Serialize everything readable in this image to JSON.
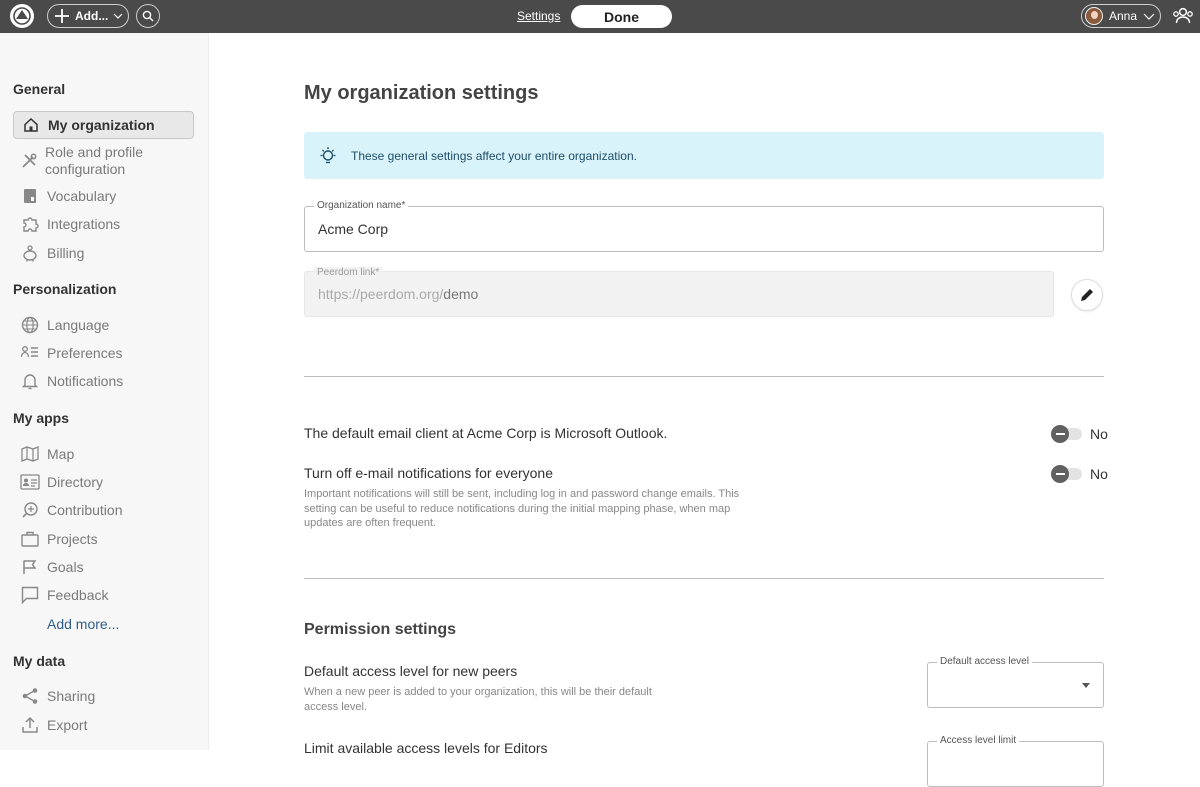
{
  "topbar": {
    "add_label": "Add...",
    "settings_link": "Settings",
    "done_button": "Done",
    "user_name": "Anna"
  },
  "sidebar": {
    "sections": [
      {
        "title": "General",
        "items": [
          {
            "label": "My organization",
            "icon": "home-icon",
            "active": true
          },
          {
            "label": "Role and profile configuration",
            "icon": "tools-icon"
          },
          {
            "label": "Vocabulary",
            "icon": "book-icon"
          },
          {
            "label": "Integrations",
            "icon": "puzzle-icon"
          },
          {
            "label": "Billing",
            "icon": "piggy-bank-icon"
          }
        ]
      },
      {
        "title": "Personalization",
        "items": [
          {
            "label": "Language",
            "icon": "globe-icon"
          },
          {
            "label": "Preferences",
            "icon": "preferences-icon"
          },
          {
            "label": "Notifications",
            "icon": "bell-icon"
          }
        ]
      },
      {
        "title": "My apps",
        "items": [
          {
            "label": "Map",
            "icon": "map-icon"
          },
          {
            "label": "Directory",
            "icon": "directory-icon"
          },
          {
            "label": "Contribution",
            "icon": "contribution-icon"
          },
          {
            "label": "Projects",
            "icon": "briefcase-icon"
          },
          {
            "label": "Goals",
            "icon": "flag-icon"
          },
          {
            "label": "Feedback",
            "icon": "comment-icon"
          }
        ]
      },
      {
        "title": "My data",
        "items": [
          {
            "label": "Sharing",
            "icon": "share-icon"
          },
          {
            "label": "Export",
            "icon": "export-icon"
          }
        ]
      }
    ],
    "add_more": "Add more..."
  },
  "main": {
    "title": "My organization settings",
    "info_text": "These general settings affect your entire organization.",
    "org_name": {
      "label": "Organization name*",
      "value": "Acme Corp"
    },
    "peerdom_link": {
      "label": "Peerdom link*",
      "prefix": "https://peerdom.org/",
      "slug": "demo"
    },
    "email_client": {
      "label": "The default email client at Acme Corp is Microsoft Outlook.",
      "toggle": "No"
    },
    "email_notifications": {
      "label": "Turn off e-mail notifications for everyone",
      "description": "Important notifications will still be sent, including log in and password change emails. This setting can be useful to reduce notifications during the initial mapping phase, when map updates are often frequent.",
      "toggle": "No"
    },
    "permissions": {
      "heading": "Permission settings",
      "default_access": {
        "label": "Default access level for new peers",
        "description": "When a new peer is added to your organization, this will be their default access level.",
        "select_label": "Default access level",
        "value": ""
      },
      "limit_access": {
        "label": "Limit available access levels for Editors",
        "select_label": "Access level limit"
      }
    }
  }
}
